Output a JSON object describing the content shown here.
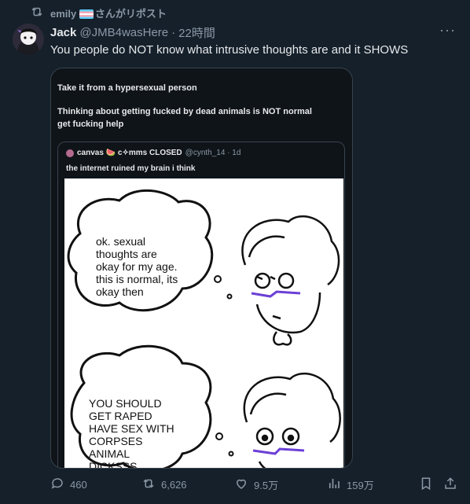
{
  "repost": {
    "user": "emily",
    "suffix": "さんがリポスト"
  },
  "tweet": {
    "name": "Jack",
    "handle": "@JMB4wasHere",
    "separator": "·",
    "time": "22時間",
    "more": "···",
    "text": "You people do NOT know what intrusive thoughts are and it SHOWS"
  },
  "quoted_image": {
    "line1": "Take it from a hypersexual person",
    "line2": "Thinking about getting fucked by dead animals is NOT normal",
    "line3": "get fucking help",
    "inner": {
      "user": "canvas 🍉 c✧mms CLOSED",
      "handle_time": "@cynth_14 · 1d",
      "text": "the internet ruined my brain i think"
    },
    "comic": {
      "panel1": [
        "ok. sexual",
        "thoughts are",
        "okay for my age.",
        "this is normal, its",
        "okay then"
      ],
      "panel2": [
        "YOU SHOULD",
        "GET RAPED",
        "HAVE SEX WITH",
        "CORPSES",
        "ANIMAL",
        "DICKSSS"
      ]
    }
  },
  "actions": {
    "replies": "460",
    "reposts": "6,626",
    "likes": "9.5万",
    "views": "159万"
  },
  "colors": {
    "background": "#15202b",
    "secondary_text": "#8b98a5",
    "border": "#38444d"
  },
  "icons": [
    "repost-icon",
    "reply-icon",
    "like-icon",
    "views-icon",
    "bookmark-icon",
    "share-icon"
  ]
}
